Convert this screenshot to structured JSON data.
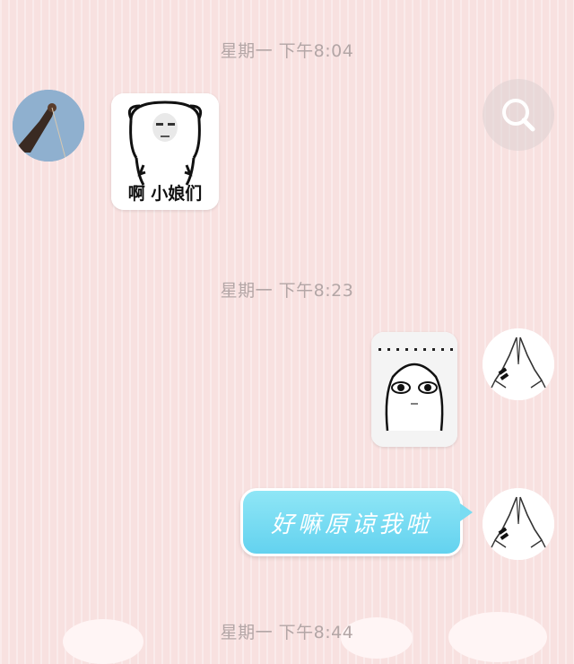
{
  "messages": {
    "timestamp_1": "星期一 下午8:04",
    "timestamp_2": "星期一 下午8:23",
    "timestamp_3": "星期一 下午8:44",
    "received_sticker_caption": "啊 小娘们",
    "sent_text": "好嘛原谅我啦"
  },
  "icons": {
    "search": "search-icon",
    "contact_avatar": "contact-avatar",
    "self_avatar": "praying-hands-avatar"
  },
  "colors": {
    "background": "#f8e1e0",
    "timestamp": "#b3a6a6",
    "bubble": "#63d2ef"
  }
}
